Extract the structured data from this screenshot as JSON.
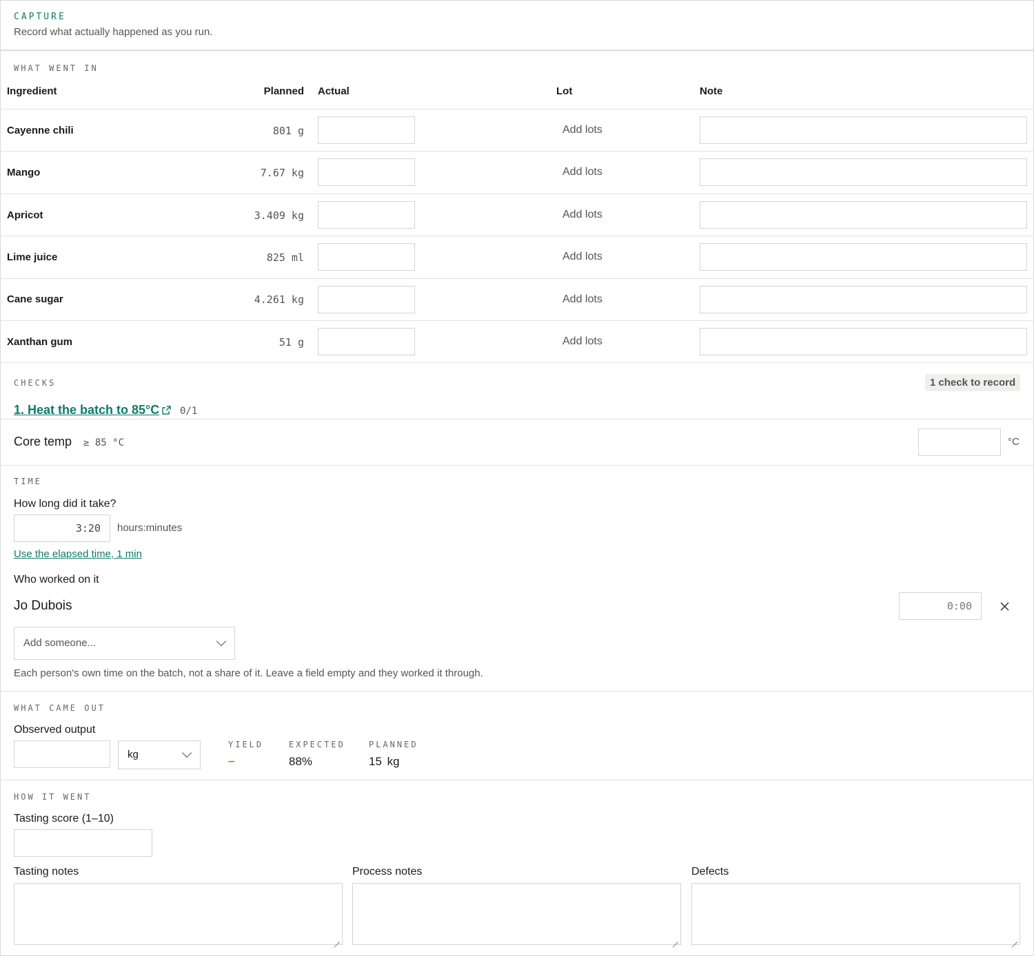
{
  "header": {
    "eyebrow": "CAPTURE",
    "subtitle": "Record what actually happened as you run."
  },
  "ingredients": {
    "eyebrow": "WHAT WENT IN",
    "columns": {
      "ingredient": "Ingredient",
      "planned": "Planned",
      "actual": "Actual",
      "lot": "Lot",
      "note": "Note"
    },
    "rows": [
      {
        "name": "Cayenne chili",
        "planned": "801 g",
        "lot_label": "Add lots"
      },
      {
        "name": "Mango",
        "planned": "7.67 kg",
        "lot_label": "Add lots"
      },
      {
        "name": "Apricot",
        "planned": "3.409 kg",
        "lot_label": "Add lots"
      },
      {
        "name": "Lime juice",
        "planned": "825 ml",
        "lot_label": "Add lots"
      },
      {
        "name": "Cane sugar",
        "planned": "4.261 kg",
        "lot_label": "Add lots"
      },
      {
        "name": "Xanthan gum",
        "planned": "51 g",
        "lot_label": "Add lots"
      }
    ]
  },
  "checks": {
    "eyebrow": "CHECKS",
    "badge": "1 check to record",
    "step_title": "1. Heat the batch to 85°C",
    "step_progress": "0/1",
    "item_label": "Core temp",
    "item_rule": "≥ 85 °C",
    "item_unit": "°C"
  },
  "time": {
    "eyebrow": "TIME",
    "question": "How long did it take?",
    "duration_value": "3:20",
    "duration_unit": "hours:minutes",
    "elapsed_link": "Use the elapsed time, 1 min",
    "workers_label": "Who worked on it",
    "worker_name": "Jo Dubois",
    "worker_time_placeholder": "0:00",
    "add_placeholder": "Add someone...",
    "help": "Each person's own time on the batch, not a share of it. Leave a field empty and they worked it through."
  },
  "output": {
    "eyebrow": "WHAT CAME OUT",
    "label": "Observed output",
    "unit": "kg",
    "yield_label": "YIELD",
    "yield_value": "–",
    "expected_label": "EXPECTED",
    "expected_value": "88%",
    "planned_label": "PLANNED",
    "planned_value": "15 kg"
  },
  "how": {
    "eyebrow": "HOW IT WENT",
    "score_label": "Tasting score (1–10)",
    "tasting_label": "Tasting notes",
    "process_label": "Process notes",
    "defects_label": "Defects"
  },
  "colors": {
    "accent": "#0f7a6c",
    "yield_dash": "#d4700f"
  }
}
